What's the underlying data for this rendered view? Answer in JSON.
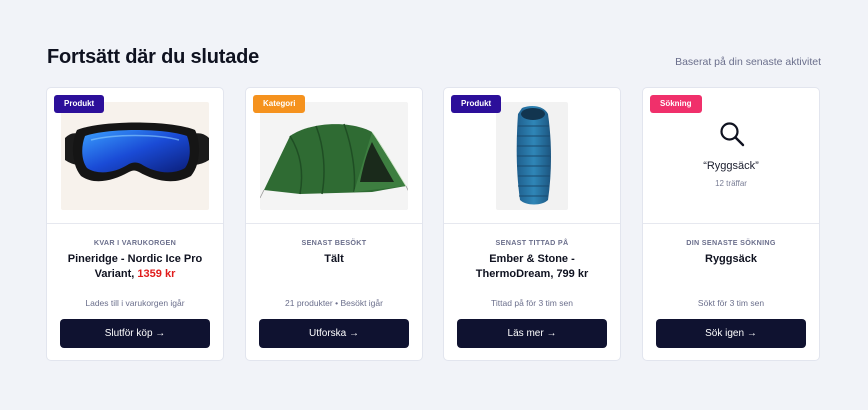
{
  "header": {
    "title": "Fortsätt där du slutade",
    "subtitle": "Baserat på din senaste aktivitet"
  },
  "colors": {
    "badge_product": "#2c0f9a",
    "badge_category": "#f5921e",
    "badge_search": "#f0306b",
    "cta": "#0f1230",
    "price_red": "#e01c1c"
  },
  "cards": [
    {
      "badge": "Produkt",
      "eyebrow": "KVAR I VARUKORGEN",
      "name": "Pineridge - Nordic Ice Pro Variant, ",
      "price": "1359 kr",
      "meta": "Lades till i varukorgen igår",
      "cta": "Slutför köp →",
      "image": "ski-goggles"
    },
    {
      "badge": "Kategori",
      "eyebrow": "SENAST BESÖKT",
      "name": "Tält",
      "meta": "21 produkter • Besökt igår",
      "cta": "Utforska →",
      "image": "tent"
    },
    {
      "badge": "Produkt",
      "eyebrow": "SENAST TITTAD PÅ",
      "name": "Ember & Stone - ThermoDream, 799 kr",
      "meta": "Tittad på för 3 tim sen",
      "cta": "Läs mer →",
      "image": "sleeping-bag"
    },
    {
      "badge": "Sökning",
      "query": "“Ryggsäck”",
      "count": "12 träffar",
      "eyebrow": "DIN SENASTE SÖKNING",
      "name": "Ryggsäck",
      "meta": "Sökt för 3 tim sen",
      "cta": "Sök igen →",
      "icon": "search-icon"
    }
  ]
}
